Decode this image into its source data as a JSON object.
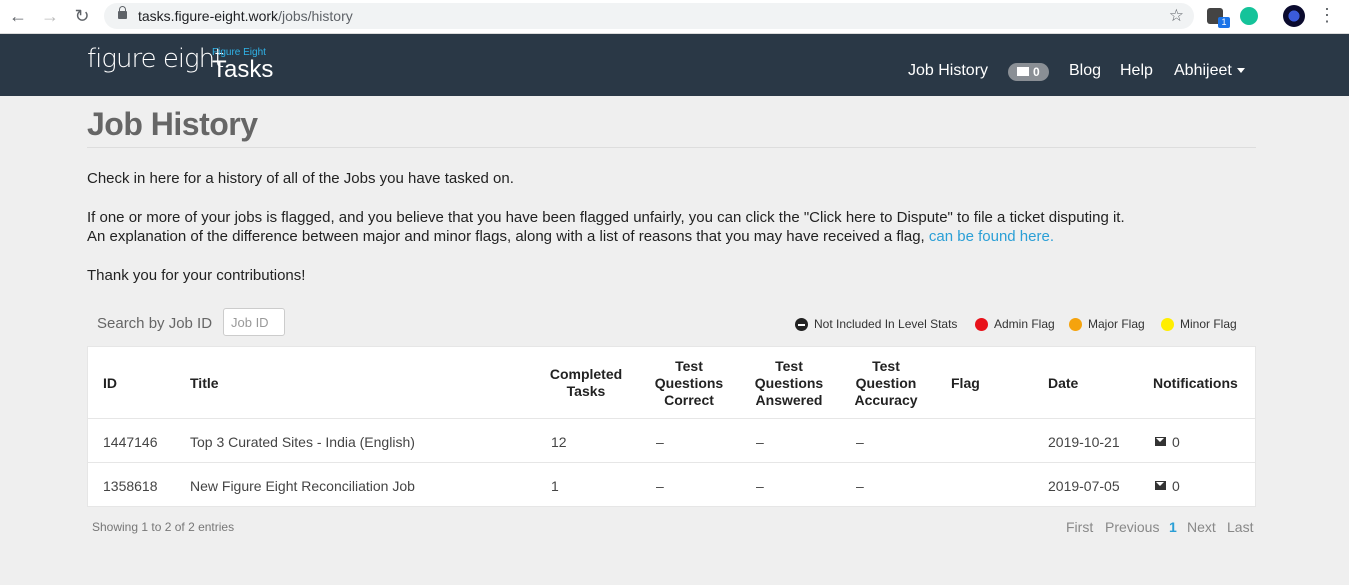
{
  "browser": {
    "url_host": "tasks.figure-eight.work",
    "url_path": "/jobs/history",
    "extension_badge": "1"
  },
  "header": {
    "logo_text": "figure eight",
    "subbrand": "Figure Eight",
    "product": "Tasks",
    "nav": {
      "job_history": "Job History",
      "messages_count": "0",
      "blog": "Blog",
      "help": "Help",
      "user": "Abhijeet"
    }
  },
  "page": {
    "title": "Job History",
    "intro": "Check in here for a history of all of the Jobs you have tasked on.",
    "dispute_line": "If one or more of your jobs is flagged, and you believe that you have been flagged unfairly, you can click the \"Click here to Dispute\" to file a ticket disputing it.",
    "explanation_line": "An explanation of the difference between major and minor flags, along with a list of reasons that you may have received a flag,",
    "explanation_link": "can be found here.",
    "thanks": "Thank you for your contributions!"
  },
  "search": {
    "label": "Search by Job ID",
    "placeholder": "Job ID"
  },
  "legend": {
    "not_included": "Not Included In Level Stats",
    "admin_flag": "Admin Flag",
    "major_flag": "Major Flag",
    "minor_flag": "Minor Flag",
    "colors": {
      "not_included": "#222222",
      "admin": "#e8121a",
      "major": "#f5a30d",
      "minor": "#ffee00"
    }
  },
  "table": {
    "headers": {
      "id": "ID",
      "title": "Title",
      "completed_1": "Completed",
      "completed_2": "Tasks",
      "tqc_1": "Test",
      "tqc_2": "Questions",
      "tqc_3": "Correct",
      "tqa_1": "Test",
      "tqa_2": "Questions",
      "tqa_3": "Answered",
      "tqacc_1": "Test",
      "tqacc_2": "Question",
      "tqacc_3": "Accuracy",
      "flag": "Flag",
      "date": "Date",
      "notifications": "Notifications"
    },
    "rows": [
      {
        "id": "1447146",
        "title": "Top 3 Curated Sites - India (English)",
        "completed": "12",
        "tqc": "–",
        "tqa": "–",
        "tqacc": "–",
        "flag": "",
        "date": "2019-10-21",
        "notifications": "0"
      },
      {
        "id": "1358618",
        "title": "New Figure Eight Reconciliation Job",
        "completed": "1",
        "tqc": "–",
        "tqa": "–",
        "tqacc": "–",
        "flag": "",
        "date": "2019-07-05",
        "notifications": "0"
      }
    ]
  },
  "footer": {
    "showing": "Showing 1 to 2 of 2 entries",
    "first": "First",
    "previous": "Previous",
    "page": "1",
    "next": "Next",
    "last": "Last"
  }
}
